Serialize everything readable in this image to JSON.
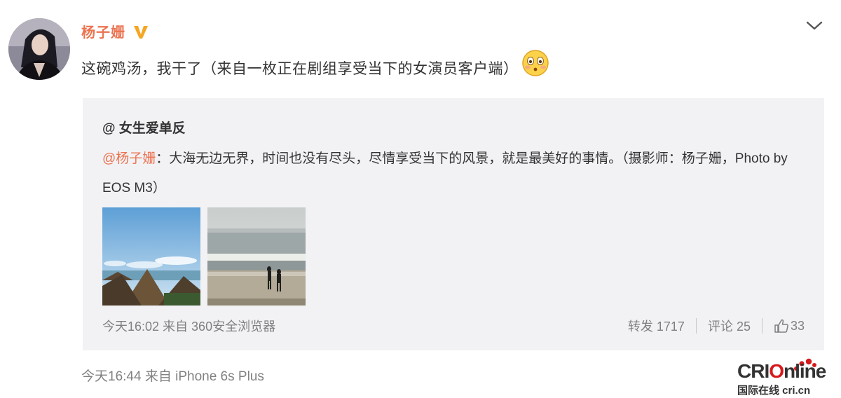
{
  "post": {
    "author": "杨子姗",
    "text": "这碗鸡汤，我干了（来自一枚正在剧组享受当下的女演员客户端）",
    "meta": "今天16:44 来自 iPhone 6s Plus"
  },
  "repost": {
    "author": "@ 女生爱单反",
    "mention": "@杨子姗",
    "text": "：大海无边无界，时间也没有尽头，尽情享受当下的风景，就是最美好的事情。（摄影师：杨子姗，Photo by EOS M3）",
    "meta": "今天16:02 来自 360安全浏览器",
    "actions": {
      "forward": "转发 1717",
      "comment": "评论 25",
      "like": "33"
    }
  },
  "watermark": {
    "logo_left": "CRI",
    "logo_right": "nline",
    "sub": "国际在线 cri.cn"
  },
  "icons": {
    "verified": "vip-v-icon",
    "menu": "chevron-down-icon",
    "emoji": "blushing-face-icon",
    "like": "thumbs-up-icon"
  },
  "colors": {
    "author": "#eb7350",
    "repost_bg": "#f2f2f5",
    "meta": "#808080"
  }
}
